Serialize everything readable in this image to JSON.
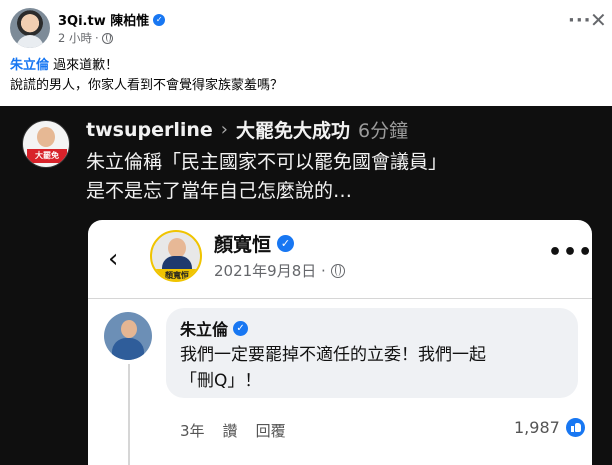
{
  "post": {
    "author": "3Qi.tw 陳柏惟",
    "time": "2 小時",
    "mention": "朱立倫",
    "line1_rest": " 過來道歉！",
    "line2": "說謊的男人，你家人看到不會覺得家族蒙羞嗎？"
  },
  "shared": {
    "avatar_badge": "大罷免",
    "username": "twsuperline",
    "chevron": "›",
    "topic": "大罷免大成功",
    "ago": "6分鐘",
    "line1": "朱立倫稱「民主國家不可以罷免國會議員」",
    "line2": "是不是忘了當年自己怎麼說的…"
  },
  "inner": {
    "page_name": "顏寬恒",
    "avatar_tag": "顏寬恒",
    "date": "2021年9月8日 ·",
    "comment": {
      "name": "朱立倫",
      "line1": "我們一定要罷掉不適任的立委！我們一起",
      "line2": "「刪Q」！",
      "age": "3年",
      "like_label": "讚",
      "reply_label": "回覆",
      "reactions": "1,987"
    }
  },
  "icons": {
    "verified": "verified-badge-icon",
    "globe": "globe-icon",
    "more": "more-options-icon",
    "close": "close-icon",
    "back": "back-arrow-icon",
    "like": "like-icon"
  },
  "colors": {
    "facebook_blue": "#1877f2",
    "dark_background": "#0f0f0f",
    "secondary_text": "#65676b"
  }
}
